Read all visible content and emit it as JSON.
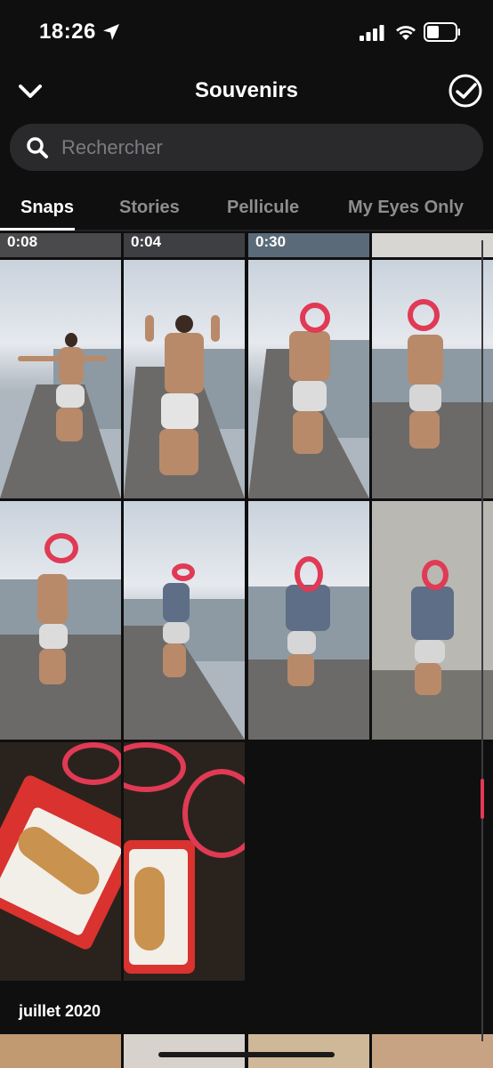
{
  "status_bar": {
    "time": "18:26",
    "icons": [
      "location-arrow-icon",
      "cellular-signal-icon",
      "wifi-icon",
      "battery-icon"
    ]
  },
  "header": {
    "title": "Souvenirs",
    "left_icon": "chevron-down-icon",
    "right_icon": "select-check-icon"
  },
  "search": {
    "placeholder": "Rechercher",
    "value": ""
  },
  "tabs": [
    {
      "label": "Snaps",
      "active": true
    },
    {
      "label": "Stories",
      "active": false
    },
    {
      "label": "Pellicule",
      "active": false
    },
    {
      "label": "My Eyes Only",
      "active": false
    }
  ],
  "grid": {
    "top_row_durations": [
      "0:08",
      "0:04",
      "0:30"
    ]
  },
  "section": {
    "label": "juillet 2020"
  },
  "colors": {
    "background": "#0f0f10",
    "search_bg": "#2a2a2d",
    "inactive_tab": "#8d8d90",
    "scribble": "#e03a55"
  }
}
